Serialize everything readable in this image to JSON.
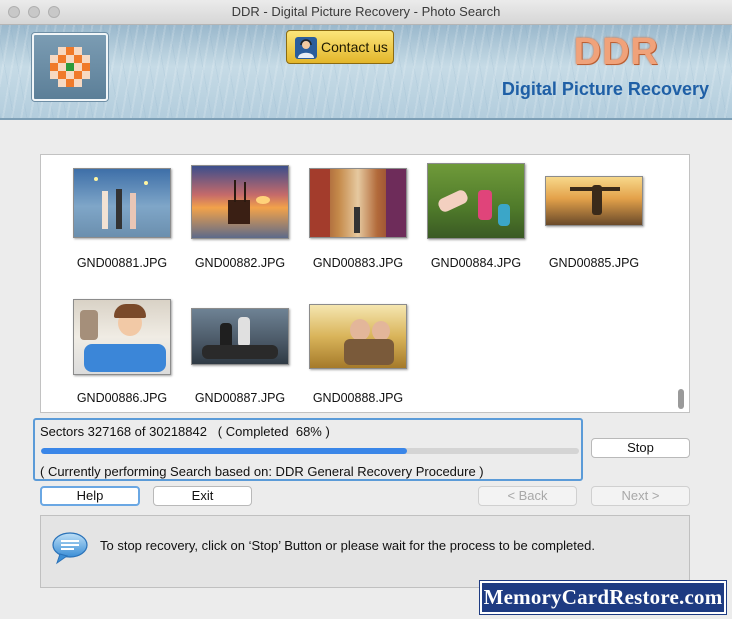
{
  "window": {
    "title": "DDR - Digital Picture Recovery - Photo Search"
  },
  "header": {
    "contact_label": "Contact us",
    "brand_name": "DDR",
    "brand_subtitle": "Digital Picture Recovery",
    "brand_color": "#1f5fa6",
    "accent_color": "#f0a27a"
  },
  "gallery": {
    "files": [
      {
        "name": "GND00881.JPG"
      },
      {
        "name": "GND00882.JPG"
      },
      {
        "name": "GND00883.JPG"
      },
      {
        "name": "GND00884.JPG"
      },
      {
        "name": "GND00885.JPG"
      },
      {
        "name": "GND00886.JPG"
      },
      {
        "name": "GND00887.JPG"
      },
      {
        "name": "GND00888.JPG"
      }
    ]
  },
  "progress": {
    "sectors_text": "Sectors 327168 of 30218842   ( Completed  68% )",
    "percent": 68,
    "bar_color": "#3a86e8",
    "procedure_text": "( Currently performing Search based on: DDR General Recovery Procedure )"
  },
  "buttons": {
    "stop": "Stop",
    "help": "Help",
    "exit": "Exit",
    "back": "< Back",
    "next": "Next >"
  },
  "info": {
    "icon": "speech-bubble-icon",
    "message": "To stop recovery, click on ‘Stop’ Button or please wait for the process to be completed."
  },
  "watermark": {
    "text": "MemoryCardRestore.com"
  }
}
